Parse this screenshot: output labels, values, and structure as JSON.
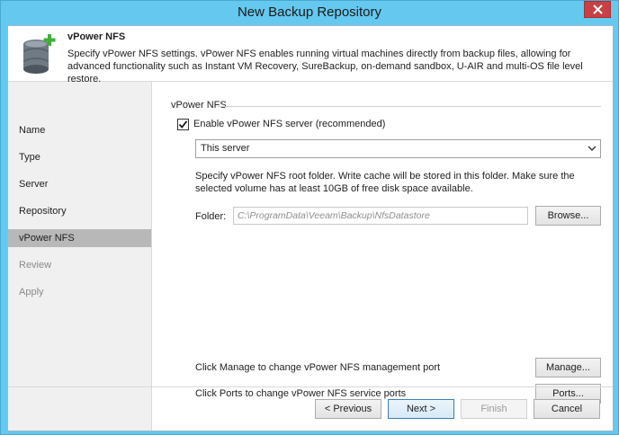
{
  "window": {
    "title": "New Backup Repository"
  },
  "header": {
    "title": "vPower NFS",
    "description": "Specify vPower NFS settings. vPower NFS enables running virtual machines directly from backup files, allowing for advanced functionality such as Instant VM Recovery, SureBackup, on-demand sandbox, U-AIR and multi-OS file level restore."
  },
  "steps": [
    {
      "label": "Name",
      "state": "normal"
    },
    {
      "label": "Type",
      "state": "normal"
    },
    {
      "label": "Server",
      "state": "normal"
    },
    {
      "label": "Repository",
      "state": "normal"
    },
    {
      "label": "vPower NFS",
      "state": "active"
    },
    {
      "label": "Review",
      "state": "disabled"
    },
    {
      "label": "Apply",
      "state": "disabled"
    }
  ],
  "nfs": {
    "group_label": "vPower NFS",
    "enable_label": "Enable vPower NFS server (recommended)",
    "enable_checked": true,
    "server_selected": "This server",
    "info": "Specify vPower NFS root folder. Write cache will be stored in this folder. Make sure the selected volume has at least 10GB of free disk space available.",
    "folder_label": "Folder:",
    "folder_value": "C:\\ProgramData\\Veeam\\Backup\\NfsDatastore",
    "browse_label": "Browse...",
    "manage_note": "Click Manage to change vPower NFS management port",
    "manage_label": "Manage...",
    "ports_note": "Click Ports to change vPower NFS service ports",
    "ports_label": "Ports..."
  },
  "footer": {
    "previous_label": "< Previous",
    "next_label": "Next >",
    "finish_label": "Finish",
    "cancel_label": "Cancel"
  },
  "icons": {
    "close": "close-icon",
    "database": "database-add-icon",
    "check": "checkmark-icon",
    "chevron": "chevron-down-icon"
  }
}
